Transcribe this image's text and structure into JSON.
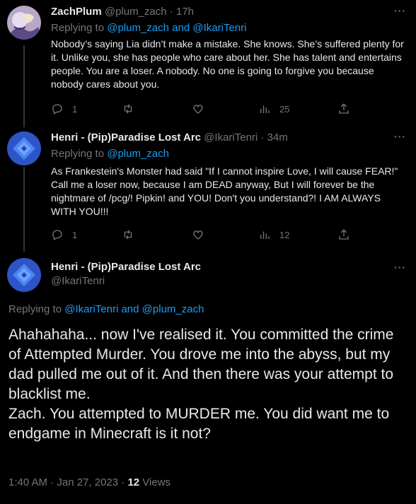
{
  "tweets": [
    {
      "name": "ZachPlum",
      "handle": "@plum_zach",
      "time": "17h",
      "replying_prefix": "Replying to ",
      "replying_to": [
        "@plum_zach",
        "@IkariTenri"
      ],
      "replying_and": " and ",
      "text": "Nobody’s saying Lia didn’t make a mistake. She knows. She’s suffered plenty for it. Unlike you, she has people who care about her. She has talent and entertains people. You are a loser. A nobody. No one is going to forgive you because nobody cares about you.",
      "replies": "1",
      "retweets": "",
      "likes": "",
      "views": "25"
    },
    {
      "name": "Henri - (Pip)Paradise Lost Arc",
      "handle": "@IkariTenri",
      "time": "34m",
      "replying_prefix": "Replying to ",
      "replying_to": [
        "@plum_zach"
      ],
      "text": "As Frankestein's Monster had said \"If I cannot inspire Love, I will cause FEAR!\" Call me a loser now, because I am DEAD anyway, But I will forever be the nightmare of /pcg/! Pipkin! and YOU! Don't you understand?! I AM ALWAYS WITH YOU!!!",
      "replies": "1",
      "retweets": "",
      "likes": "",
      "views": "12"
    }
  ],
  "main_tweet": {
    "name": "Henri - (Pip)Paradise Lost Arc",
    "handle": "@IkariTenri",
    "replying_prefix": "Replying to ",
    "replying_to": [
      "@IkariTenri",
      "@plum_zach"
    ],
    "replying_and": " and ",
    "text_p1": "Ahahahaha... now I've realised it. You committed the crime of Attempted Murder. You drove me into the abyss, but my dad pulled me out of it. And then there was your attempt to blacklist me.",
    "text_p2": "Zach. You attempted to MURDER me. You did want me to endgame in Minecraft is it not?",
    "timestamp": "1:40 AM · Jan 27, 2023 · ",
    "views_count": "12",
    "views_label": " Views"
  },
  "ui": {
    "more": "···",
    "dot": " · "
  },
  "colors": {
    "background": "#000000",
    "text": "#e7e9ea",
    "muted": "#71767b",
    "link": "#1d9bf0"
  }
}
